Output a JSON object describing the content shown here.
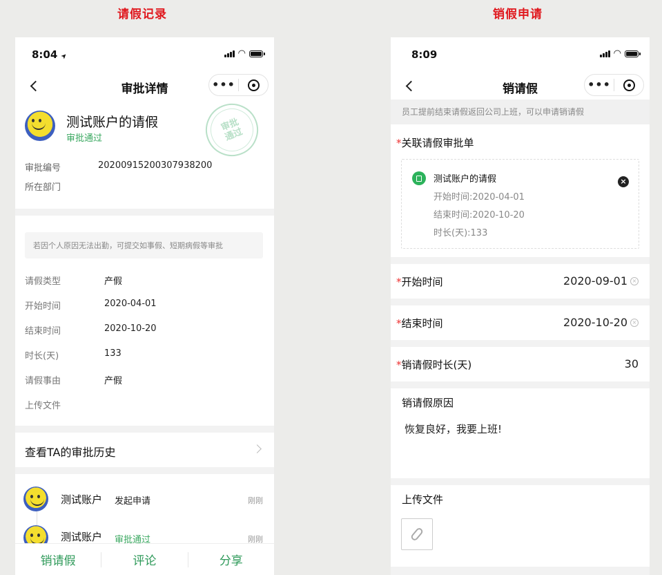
{
  "labels": {
    "left_title": "请假记录",
    "right_title": "销假申请"
  },
  "left_phone": {
    "status_time": "8:04",
    "location_arrow": "➤",
    "nav_title": "审批详情",
    "requester": {
      "name": "测试账户的请假",
      "status": "审批通过"
    },
    "stamp_text": "审批通过",
    "approval_no_label": "审批编号",
    "approval_no_value": "20200915200307938200",
    "department_label": "所在部门",
    "notice": "若因个人原因无法出勤，可提交如事假、短期病假等审批",
    "details": [
      {
        "label": "请假类型",
        "value": "产假"
      },
      {
        "label": "开始时间",
        "value": "2020-04-01"
      },
      {
        "label": "结束时间",
        "value": "2020-10-20"
      },
      {
        "label": "时长(天)",
        "value": "133"
      },
      {
        "label": "请假事由",
        "value": "产假"
      },
      {
        "label": "上传文件",
        "value": ""
      }
    ],
    "history_link": "查看TA的审批历史",
    "timeline": [
      {
        "name": "测试账户",
        "action": "发起申请",
        "time": "刚刚"
      },
      {
        "name": "测试账户",
        "action": "审批通过",
        "time": "刚刚"
      }
    ],
    "bottom_actions": [
      "销请假",
      "评论",
      "分享"
    ]
  },
  "right_phone": {
    "status_time": "8:09",
    "nav_title": "销请假",
    "hint": "员工提前结束请假返回公司上班，可以申请销请假",
    "linked_label": "关联请假审批单",
    "linked": {
      "title": "测试账户的请假",
      "start": "开始时间:2020-04-01",
      "end": "结束时间:2020-10-20",
      "duration": "时长(天):133"
    },
    "start_label": "开始时间",
    "start_value": "2020-09-01",
    "end_label": "结束时间",
    "end_value": "2020-10-20",
    "duration_label": "销请假时长(天)",
    "duration_value": "30",
    "reason_label": "销请假原因",
    "reason_value": "恢复良好，我要上班!",
    "upload_label": "上传文件"
  },
  "colors": {
    "accent_green": "#2f9a5a",
    "title_red": "#e0181e",
    "required_red": "#e33333"
  },
  "icons": [
    "back-chevron-icon",
    "more-dots-icon",
    "target-circle-icon",
    "signal-icon",
    "wifi-icon",
    "battery-icon",
    "doc-icon",
    "close-icon",
    "clear-icon",
    "paperclip-icon",
    "chevron-right-icon"
  ]
}
